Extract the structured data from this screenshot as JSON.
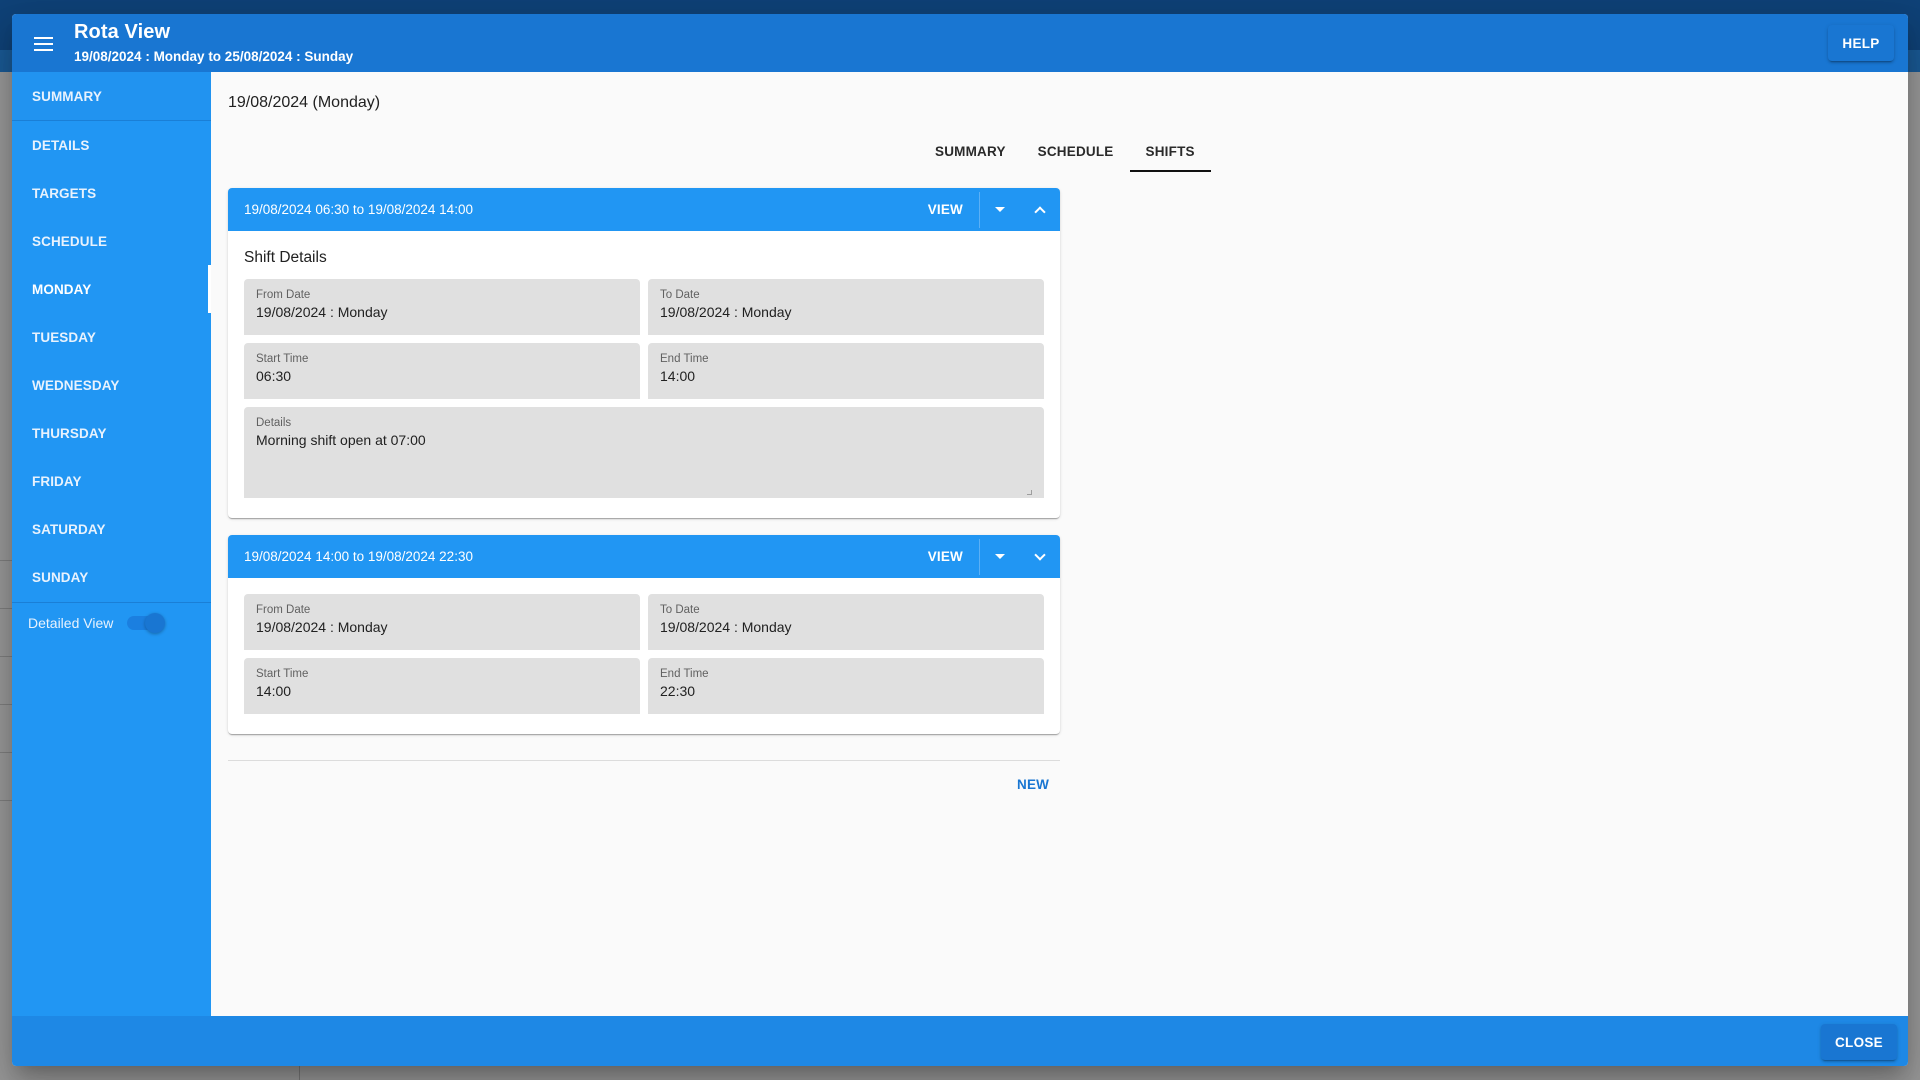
{
  "header": {
    "title": "Rota View",
    "subtitle": "19/08/2024 : Monday to 25/08/2024 : Sunday",
    "menu_icon": "hamburger-menu-icon",
    "help_label": "HELP"
  },
  "sidebar": {
    "items": [
      {
        "label": "SUMMARY"
      },
      {
        "label": "DETAILS"
      },
      {
        "label": "TARGETS"
      },
      {
        "label": "SCHEDULE"
      },
      {
        "label": "MONDAY",
        "active": true
      },
      {
        "label": "TUESDAY"
      },
      {
        "label": "WEDNESDAY"
      },
      {
        "label": "THURSDAY"
      },
      {
        "label": "FRIDAY"
      },
      {
        "label": "SATURDAY"
      },
      {
        "label": "SUNDAY"
      }
    ],
    "toggle": {
      "label": "Detailed View",
      "checked": true
    }
  },
  "main": {
    "date_heading": "19/08/2024 (Monday)",
    "tabs": [
      {
        "label": "SUMMARY"
      },
      {
        "label": "SCHEDULE"
      },
      {
        "label": "SHIFTS",
        "active": true
      }
    ],
    "shifts": [
      {
        "title": "19/08/2024 06:30 to 19/08/2024 14:00",
        "view_label": "VIEW",
        "expanded": true,
        "section_title": "Shift Details",
        "from_date": {
          "label": "From Date",
          "value": "19/08/2024 : Monday"
        },
        "to_date": {
          "label": "To Date",
          "value": "19/08/2024 : Monday"
        },
        "start_time": {
          "label": "Start Time",
          "value": "06:30"
        },
        "end_time": {
          "label": "End Time",
          "value": "14:00"
        },
        "details": {
          "label": "Details",
          "value": "Morning shift open at 07:00"
        }
      },
      {
        "title": "19/08/2024 14:00 to 19/08/2024 22:30",
        "view_label": "VIEW",
        "expanded": false,
        "from_date": {
          "label": "From Date",
          "value": "19/08/2024 : Monday"
        },
        "to_date": {
          "label": "To Date",
          "value": "19/08/2024 : Monday"
        },
        "start_time": {
          "label": "Start Time",
          "value": "14:00"
        },
        "end_time": {
          "label": "End Time",
          "value": "22:30"
        }
      }
    ],
    "new_label": "NEW"
  },
  "footer": {
    "close_label": "CLOSE"
  },
  "colors": {
    "header": "#1976d2",
    "sidebar": "#2196f3",
    "card_header": "#2196f3",
    "footer": "#1e88e5",
    "field_bg": "#e0e0e0",
    "link": "#1976d2"
  }
}
